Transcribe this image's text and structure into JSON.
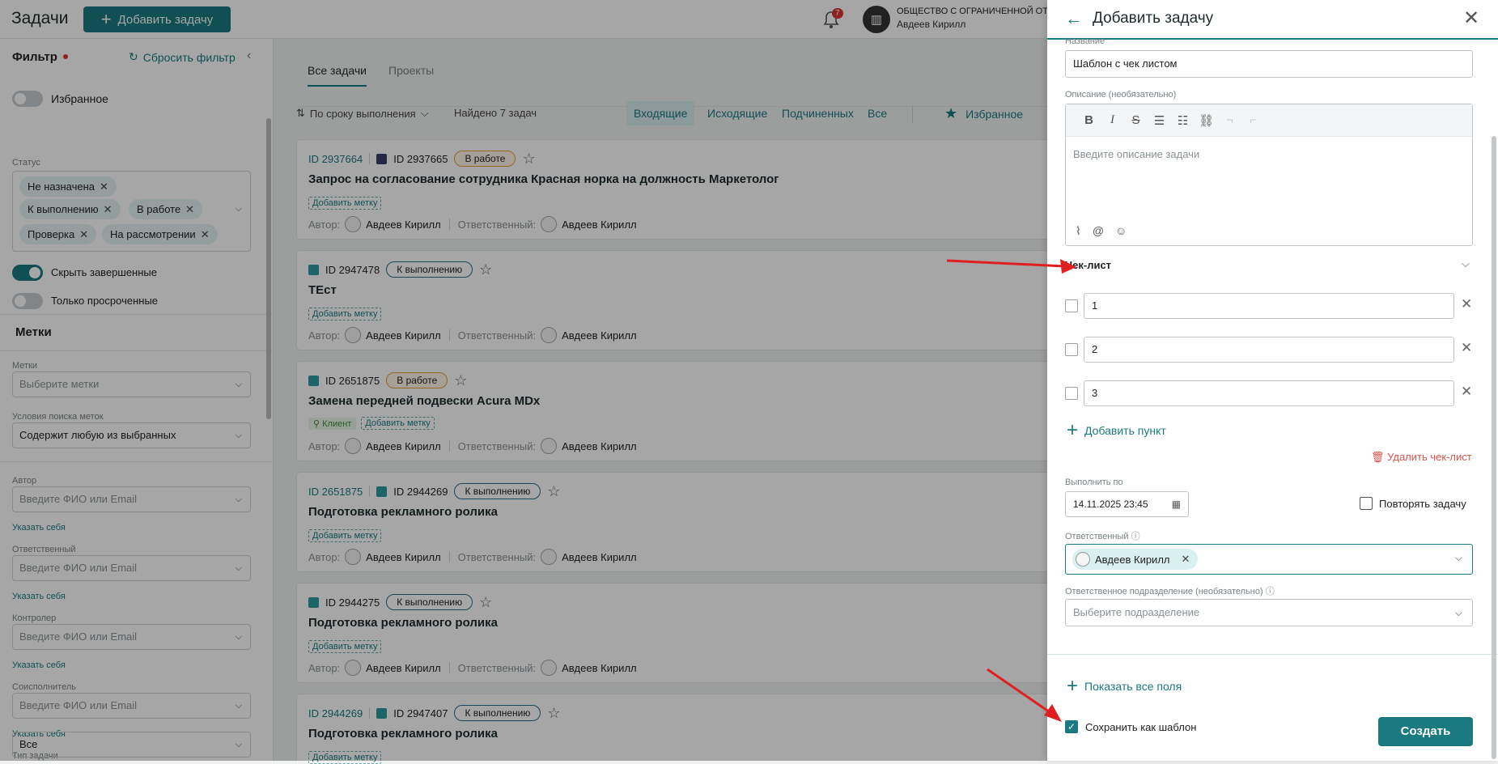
{
  "header": {
    "title": "Задачи",
    "add_button": "Добавить задачу",
    "notifications_count": "7",
    "org_name": "ОБЩЕСТВО С ОГРАНИЧЕННОЙ ОТВ",
    "user_name": "Авдеев Кирилл"
  },
  "filter": {
    "title": "Фильтр",
    "reset": "Сбросить фильтр",
    "favorites": "Избранное",
    "status_label": "Статус",
    "status_chips": [
      "Не назначена",
      "К выполнению",
      "В работе",
      "Проверка",
      "На рассмотрении"
    ],
    "hide_completed": "Скрыть завершенные",
    "only_overdue": "Только просроченные",
    "tags_section": "Метки",
    "tags_label": "Метки",
    "tags_placeholder": "Выберите метки",
    "tag_search_label": "Условия поиска меток",
    "tag_search_value": "Содержит любую из выбранных",
    "author_label": "Автор",
    "person_placeholder": "Введите ФИО или Email",
    "specify_self": "Указать себя",
    "responsible_label": "Ответственный",
    "controller_label": "Контролер",
    "coexecutor_label": "Соисполнитель",
    "task_type_label": "Тип задачи",
    "task_type_value": "Все"
  },
  "main": {
    "tabs": [
      "Все задачи",
      "Проекты"
    ],
    "sort": "По сроку выполнения",
    "found": "Найдено 7 задач",
    "segments": [
      "Входящие",
      "Исходящие",
      "Подчиненных",
      "Все"
    ],
    "favorites": "Избранное",
    "add_tag": "Добавить метку",
    "author_prefix": "Автор:",
    "responsible_prefix": "Ответственный:",
    "cards": [
      {
        "parent_id": "ID 2937664",
        "id": "ID 2937665",
        "status": "В работе",
        "title": "Запрос на согласование сотрудника Красная норка на должность Маркетолог",
        "author": "Авдеев Кирилл",
        "responsible": "Авдеев Кирилл"
      },
      {
        "parent_id": "",
        "id": "ID 2947478",
        "status": "К выполнению",
        "title": "ТЕст",
        "author": "Авдеев Кирилл",
        "responsible": "Авдеев Кирилл"
      },
      {
        "parent_id": "",
        "id": "ID 2651875",
        "status": "В работе",
        "title": "Замена передней подвески Acura MDx",
        "tag": "Клиент",
        "author": "Авдеев Кирилл",
        "responsible": "Авдеев Кирилл"
      },
      {
        "parent_id": "ID 2651875",
        "id": "ID 2944269",
        "status": "К выполнению",
        "title": "Подготовка рекламного ролика",
        "author": "Авдеев Кирилл",
        "responsible": "Авдеев Кирилл"
      },
      {
        "parent_id": "",
        "id": "ID 2944275",
        "status": "К выполнению",
        "title": "Подготовка рекламного ролика",
        "author": "Авдеев Кирилл",
        "responsible": "Авдеев Кирилл"
      },
      {
        "parent_id": "ID 2944269",
        "id": "ID 2947407",
        "status": "К выполнению",
        "title": "Подготовка рекламного ролика",
        "author": "",
        "responsible": ""
      }
    ]
  },
  "drawer": {
    "title": "Добавить задачу",
    "name_label": "Название",
    "name_value": "Шаблон с чек листом",
    "desc_label": "Описание (необязательно)",
    "desc_placeholder": "Введите описание задачи",
    "checklist_title": "Чек-лист",
    "checklist_items": [
      "1",
      "2",
      "3"
    ],
    "add_item": "Добавить пункт",
    "delete_checklist": "Удалить чек-лист",
    "due_label": "Выполнить по",
    "due_value": "14.11.2025 23:45",
    "repeat": "Повторять задачу",
    "responsible_label": "Ответственный",
    "responsible_value": "Авдеев Кирилл",
    "dept_label": "Ответственное подразделение (необязательно)",
    "dept_placeholder": "Выберите подразделение",
    "show_all": "Показать все поля",
    "save_template": "Сохранить как шаблон",
    "create": "Создать"
  },
  "colors": {
    "accent": "#1a7a80",
    "arrow": "#e02020",
    "danger": "#d9534f"
  }
}
